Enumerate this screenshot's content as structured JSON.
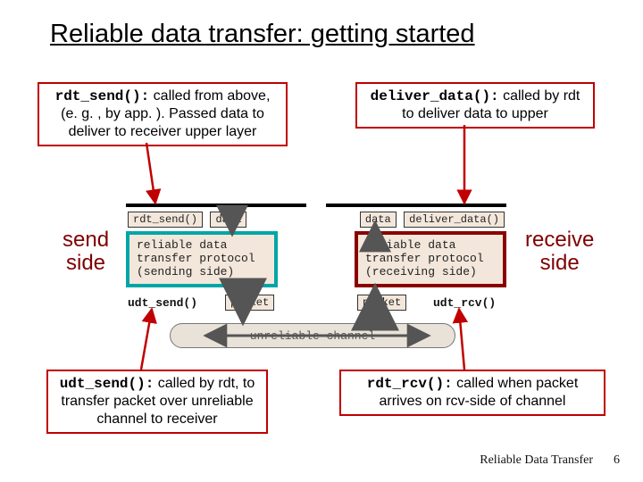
{
  "title": "Reliable data transfer: getting started",
  "callouts": {
    "rdt_send": {
      "code": "rdt_send():",
      "text": " called from above, (e. g. , by app. ). Passed data to deliver to receiver upper layer"
    },
    "deliver_data": {
      "code": "deliver_data():",
      "text": " called by rdt to deliver data to upper"
    },
    "udt_send": {
      "code": "udt_send():",
      "text": " called by rdt, to transfer packet over unreliable channel to receiver"
    },
    "rdt_rcv": {
      "code": "rdt_rcv():",
      "text": " called when packet arrives on rcv-side of channel"
    }
  },
  "labels": {
    "send_side": "send\nside",
    "receive_side": "receive\nside"
  },
  "diagram": {
    "rdt_send_box": "rdt_send()",
    "data_box": "data",
    "deliver_data_box": "deliver_data()",
    "sending_proto_l1": "reliable data",
    "sending_proto_l2": "transfer protocol",
    "sending_proto_l3": "(sending side)",
    "receiving_proto_l1": "reliable data",
    "receiving_proto_l2": "transfer protocol",
    "receiving_proto_l3": "(receiving side)",
    "udt_send_box": "udt_send()",
    "udt_rcv_box": "udt_rcv()",
    "packet_box_l": "packet",
    "packet_box_r": "packet",
    "unreliable": "unreliable channel"
  },
  "footer": {
    "name": "Reliable Data Transfer",
    "page": "6"
  }
}
